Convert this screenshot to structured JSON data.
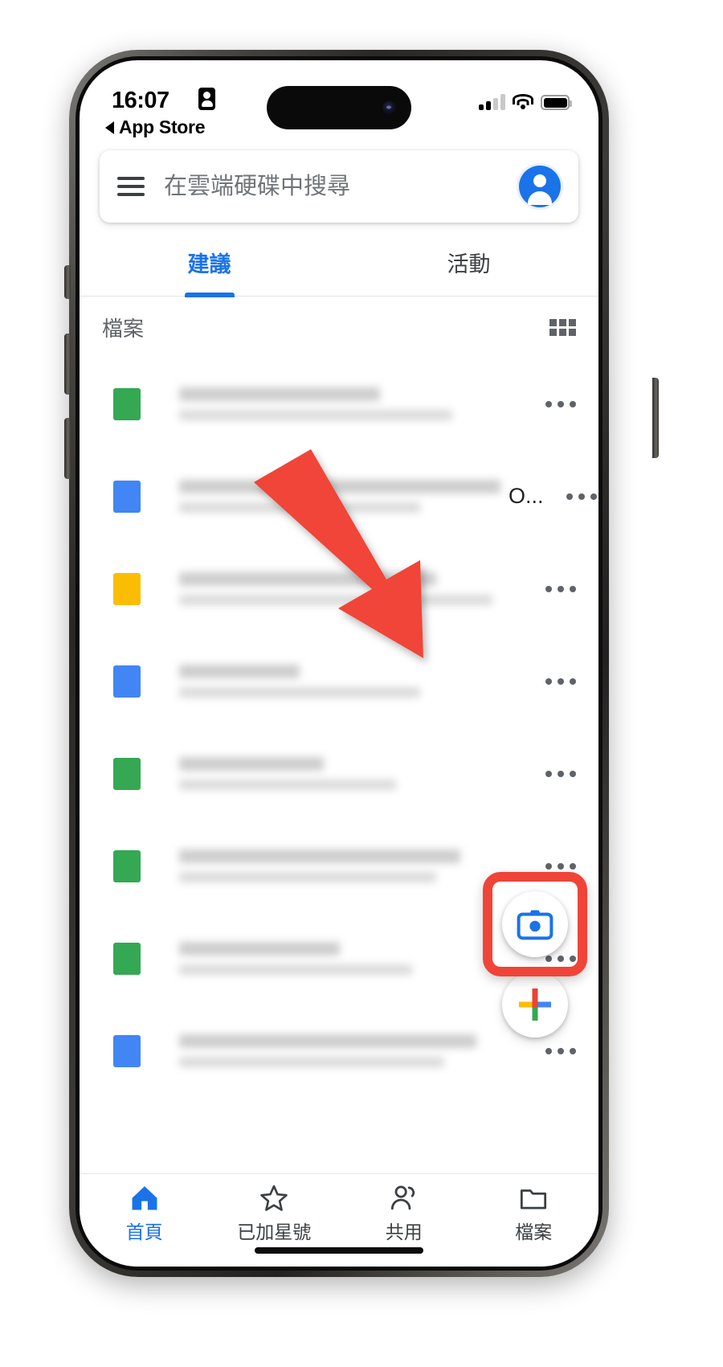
{
  "status_bar": {
    "time": "16:07",
    "record_icon": "screen-record-badge-icon",
    "back_arrow_icon": "back-triangle-icon",
    "back_label": "App Store",
    "signal_icon": "cellular-signal-icon",
    "wifi_icon": "wifi-icon",
    "battery_icon": "battery-full-icon"
  },
  "search": {
    "menu_icon": "hamburger-menu-icon",
    "placeholder": "在雲端硬碟中搜尋",
    "value": "",
    "avatar_icon": "account-avatar-icon"
  },
  "tabs": [
    {
      "label": "建議",
      "active": true
    },
    {
      "label": "活動",
      "active": false
    }
  ],
  "section": {
    "title": "檔案",
    "grid_icon": "grid-view-icon"
  },
  "files": [
    {
      "icon": "sheets-file-icon",
      "color": "green",
      "title_redacted": true,
      "title_width": 250,
      "sub_width": 340,
      "suffix": ""
    },
    {
      "icon": "docs-file-icon",
      "color": "blue",
      "title_redacted": true,
      "title_width": 400,
      "sub_width": 300,
      "suffix": "O..."
    },
    {
      "icon": "folder-file-icon",
      "color": "yellow",
      "title_redacted": true,
      "title_width": 320,
      "sub_width": 390,
      "suffix": ""
    },
    {
      "icon": "docs-file-icon",
      "color": "blue",
      "title_redacted": true,
      "title_width": 150,
      "sub_width": 300,
      "suffix": ""
    },
    {
      "icon": "sheets-file-icon",
      "color": "green",
      "title_redacted": true,
      "title_width": 180,
      "sub_width": 270,
      "suffix": ""
    },
    {
      "icon": "sheets-file-icon",
      "color": "green",
      "title_redacted": true,
      "title_width": 350,
      "sub_width": 320,
      "suffix": ""
    },
    {
      "icon": "sheets-file-icon",
      "color": "green",
      "title_redacted": true,
      "title_width": 200,
      "sub_width": 290,
      "suffix": ""
    },
    {
      "icon": "docs-file-icon",
      "color": "blue",
      "title_redacted": true,
      "title_width": 370,
      "sub_width": 330,
      "suffix": ""
    }
  ],
  "fabs": {
    "camera": {
      "icon": "camera-scan-icon",
      "color": "#1a73e8"
    },
    "plus": {
      "icon": "google-plus-new-icon",
      "colors": {
        "top": "#ea4335",
        "left": "#fbbc04",
        "right": "#4285f4",
        "bottom": "#34a853"
      }
    }
  },
  "annotation": {
    "arrow_color": "#f04438",
    "highlight_color": "#f04438",
    "highlight_target": "camera-fab"
  },
  "bottom_nav": [
    {
      "label": "首頁",
      "icon": "home-icon",
      "active": true
    },
    {
      "label": "已加星號",
      "icon": "star-icon",
      "active": false
    },
    {
      "label": "共用",
      "icon": "people-icon",
      "active": false
    },
    {
      "label": "檔案",
      "icon": "folder-icon",
      "active": false
    }
  ],
  "colors": {
    "accent_blue": "#1a73e8",
    "google_green": "#34a853",
    "google_blue": "#4285f4",
    "google_yellow": "#fbbc04",
    "google_red": "#ea4335",
    "annotation_red": "#f04438"
  }
}
